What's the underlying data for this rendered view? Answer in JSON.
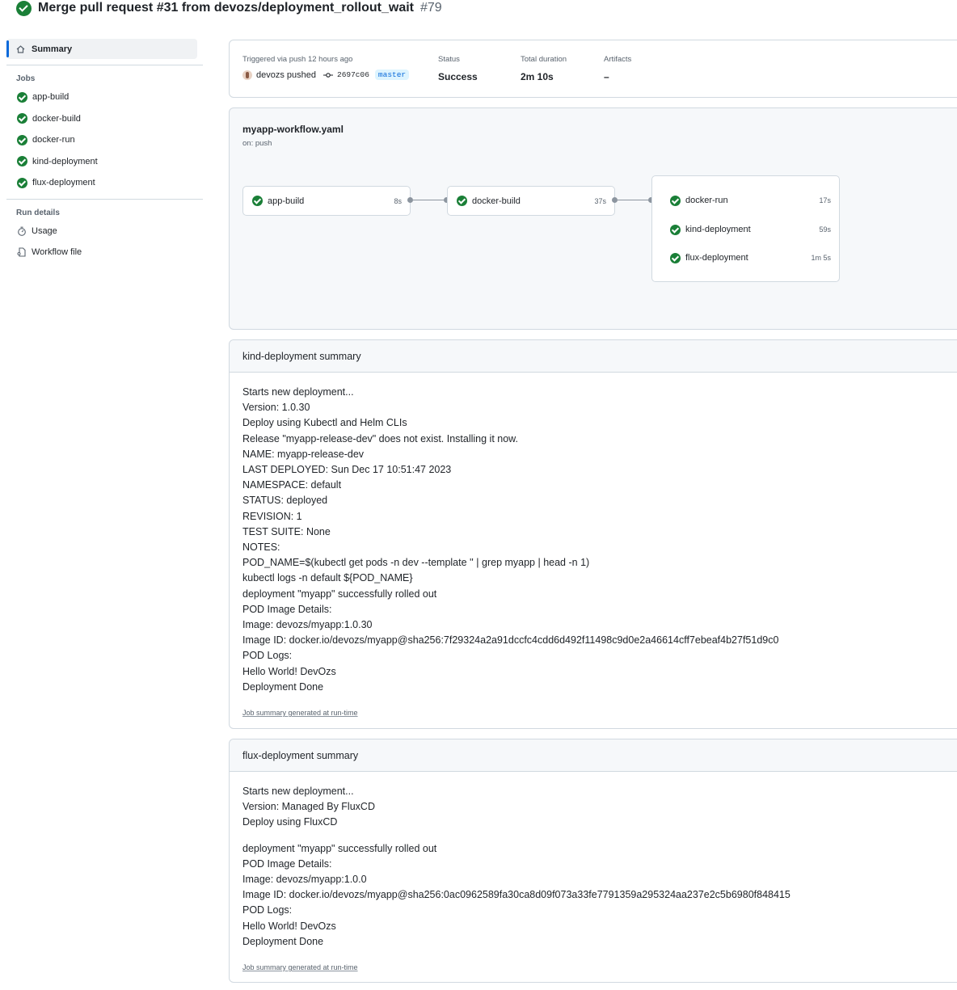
{
  "header": {
    "title": "Merge pull request #31 from devozs/deployment_rollout_wait",
    "run_number": "#79"
  },
  "sidebar": {
    "summary_label": "Summary",
    "jobs_heading": "Jobs",
    "jobs": [
      {
        "label": "app-build"
      },
      {
        "label": "docker-build"
      },
      {
        "label": "docker-run"
      },
      {
        "label": "kind-deployment"
      },
      {
        "label": "flux-deployment"
      }
    ],
    "run_details_heading": "Run details",
    "usage_label": "Usage",
    "workflow_file_label": "Workflow file"
  },
  "meta": {
    "trigger_label": "Triggered via push 12 hours ago",
    "actor": "devozs pushed",
    "commit_sha": "2697c06",
    "branch": "master",
    "status_label": "Status",
    "status_value": "Success",
    "duration_label": "Total duration",
    "duration_value": "2m 10s",
    "artifacts_label": "Artifacts",
    "artifacts_value": "–"
  },
  "workflow": {
    "name": "myapp-workflow.yaml",
    "on": "on: push",
    "jobs": [
      {
        "label": "app-build",
        "duration": "8s"
      },
      {
        "label": "docker-build",
        "duration": "37s"
      }
    ],
    "group": [
      {
        "label": "docker-run",
        "duration": "17s"
      },
      {
        "label": "kind-deployment",
        "duration": "59s"
      },
      {
        "label": "flux-deployment",
        "duration": "1m 5s"
      }
    ]
  },
  "kind_summary": {
    "title": "kind-deployment summary",
    "lines": [
      "Starts new deployment...",
      "Version: 1.0.30",
      "Deploy using Kubectl and Helm CLIs",
      "Release \"myapp-release-dev\" does not exist. Installing it now.",
      "NAME: myapp-release-dev",
      "LAST DEPLOYED: Sun Dec 17 10:51:47 2023",
      "NAMESPACE: default",
      "STATUS: deployed",
      "REVISION: 1",
      "TEST SUITE: None",
      "NOTES:",
      "POD_NAME=$(kubectl get pods -n dev --template '' | grep myapp | head -n 1)",
      "kubectl logs -n default ${POD_NAME}",
      "deployment \"myapp\" successfully rolled out",
      "POD Image Details:",
      "Image: devozs/myapp:1.0.30",
      "Image ID: docker.io/devozs/myapp@sha256:7f29324a2a91dccfc4cdd6d492f11498c9d0e2a46614cff7ebeaf4b27f51d9c0",
      "POD Logs:",
      "Hello World! DevOzs",
      "Deployment Done"
    ],
    "footer": "Job summary generated at run-time"
  },
  "flux_summary": {
    "title": "flux-deployment summary",
    "lines_a": [
      "Starts new deployment...",
      "Version: Managed By FluxCD",
      "Deploy using FluxCD"
    ],
    "lines_b": [
      "deployment \"myapp\" successfully rolled out",
      "POD Image Details:",
      "Image: devozs/myapp:1.0.0",
      "Image ID: docker.io/devozs/myapp@sha256:0ac0962589fa30ca8d09f073a33fe7791359a295324aa237e2c5b6980f848415",
      "POD Logs:",
      "Hello World! DevOzs",
      "Deployment Done"
    ],
    "footer": "Job summary generated at run-time"
  },
  "colors": {
    "success": "#1a7f37",
    "accent": "#0969da",
    "border": "#d1d9e0"
  }
}
